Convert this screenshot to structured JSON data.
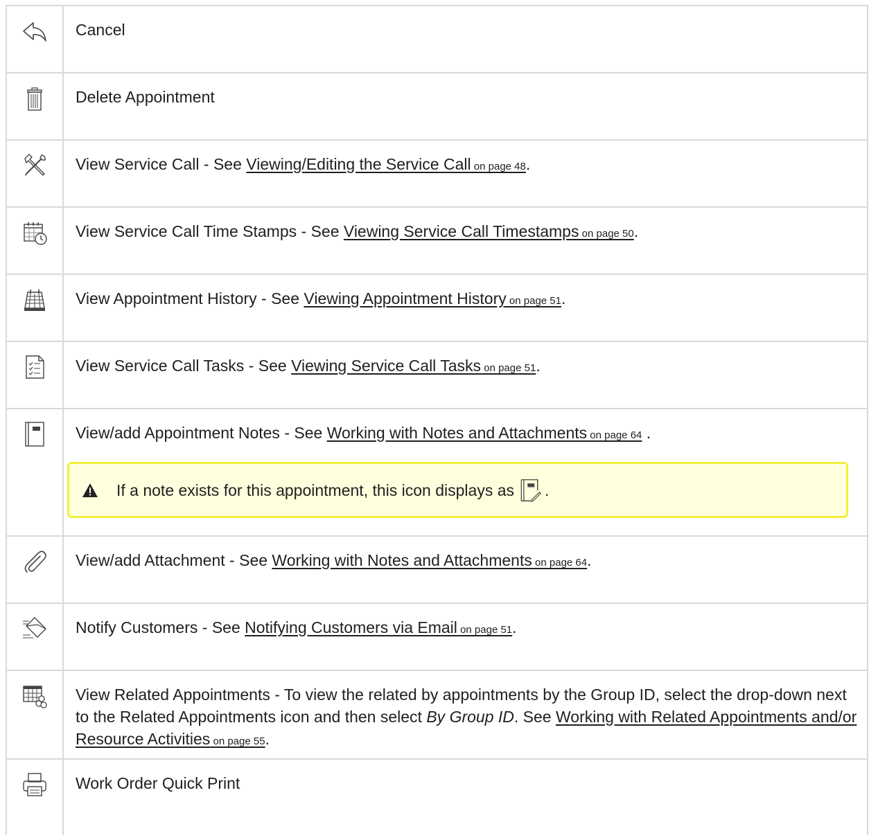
{
  "rows": [
    {
      "id": "cancel",
      "icon": "undo-arrow-icon",
      "text": "Cancel"
    },
    {
      "id": "delete",
      "icon": "trash-can-icon",
      "text": "Delete Appointment"
    },
    {
      "id": "view-service-call",
      "icon": "tools-icon",
      "text": "View Service Call - See ",
      "link": "Viewing/Editing the Service Call",
      "page": " on page 48",
      "end": "."
    },
    {
      "id": "time-stamps",
      "icon": "calendar-clock-icon",
      "text": "View Service Call Time Stamps - See ",
      "link": "Viewing Service Call Timestamps",
      "page": " on page 50",
      "end": "."
    },
    {
      "id": "appt-history",
      "icon": "calendar-icon",
      "text": "View Appointment History - See ",
      "link": "Viewing Appointment History",
      "page": " on page 51",
      "end": "."
    },
    {
      "id": "tasks",
      "icon": "checklist-icon",
      "text": "View Service Call Tasks - See ",
      "link": "Viewing Service Call Tasks",
      "page": " on page 51",
      "end": "."
    },
    {
      "id": "notes",
      "icon": "notebook-icon",
      "text": "View/add Appointment Notes - See ",
      "link": "Working with Notes and Attachments",
      "page": " on page 64",
      "end": " .",
      "note": {
        "icon": "warning-icon",
        "text": "If a note exists for this appointment, this icon displays as",
        "inline_icon": "notebook-edit-icon",
        "end": "."
      }
    },
    {
      "id": "attachment",
      "icon": "paperclip-icon",
      "text": "View/add Attachment - See ",
      "link": "Working with Notes and Attachments",
      "page": " on page 64",
      "end": "."
    },
    {
      "id": "notify",
      "icon": "envelope-icon",
      "text": "Notify Customers - See ",
      "link": "Notifying Customers via Email",
      "page": " on page 51",
      "end": "."
    },
    {
      "id": "related",
      "icon": "calendar-group-icon",
      "text": "View Related Appointments - To view the related by appointments by the Group ID, select the drop-down next to the Related Appointments icon and then select ",
      "italic": "By Group ID",
      "text2": ". See ",
      "link": "Working with Related Appointments and/or Resource Activities",
      "page": " on page 55",
      "end": "."
    },
    {
      "id": "print",
      "icon": "printer-icon",
      "text": "Work Order Quick Print"
    }
  ]
}
